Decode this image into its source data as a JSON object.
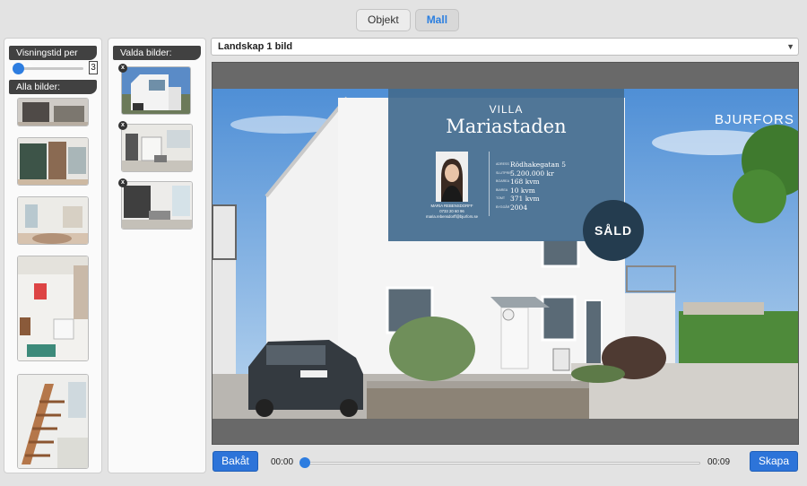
{
  "tabs": [
    {
      "label": "Objekt",
      "active": false
    },
    {
      "label": "Mall",
      "active": true
    }
  ],
  "left_panel": {
    "display_time_label": "Visningstid per bild:",
    "display_time_value": "3",
    "all_images_label": "Alla bilder:"
  },
  "mid_panel": {
    "selected_images_label": "Valda bilder:",
    "remove_label": "x"
  },
  "template_select": {
    "value": "Landskap 1 bild"
  },
  "preview": {
    "villa_label": "VILLA",
    "street": "Mariastaden",
    "agent": {
      "name": "MARIA REBENSDORFF",
      "phone": "0733 20 60 96",
      "email": "maria.rebensdorff@bjurfors.se"
    },
    "facts": [
      {
        "key": "ADRESS",
        "value": "Rödhakegatan 5"
      },
      {
        "key": "SLUTPRIS",
        "value": "5.200.000 kr"
      },
      {
        "key": "BOAREA",
        "value": "168 kvm"
      },
      {
        "key": "BIAREA",
        "value": "10 kvm"
      },
      {
        "key": "TOMT",
        "value": "371 kvm"
      },
      {
        "key": "BYGGÅR",
        "value": "2004"
      }
    ],
    "sold_badge": "SÅLD",
    "brand": "BJURFORS"
  },
  "controls": {
    "back_label": "Bakåt",
    "create_label": "Skapa",
    "time_start": "00:00",
    "time_end": "00:09",
    "position_fraction": 0
  },
  "colors": {
    "accent": "#2d74d9",
    "infobox": "#436c8f",
    "sold_badge": "#243c4f"
  }
}
